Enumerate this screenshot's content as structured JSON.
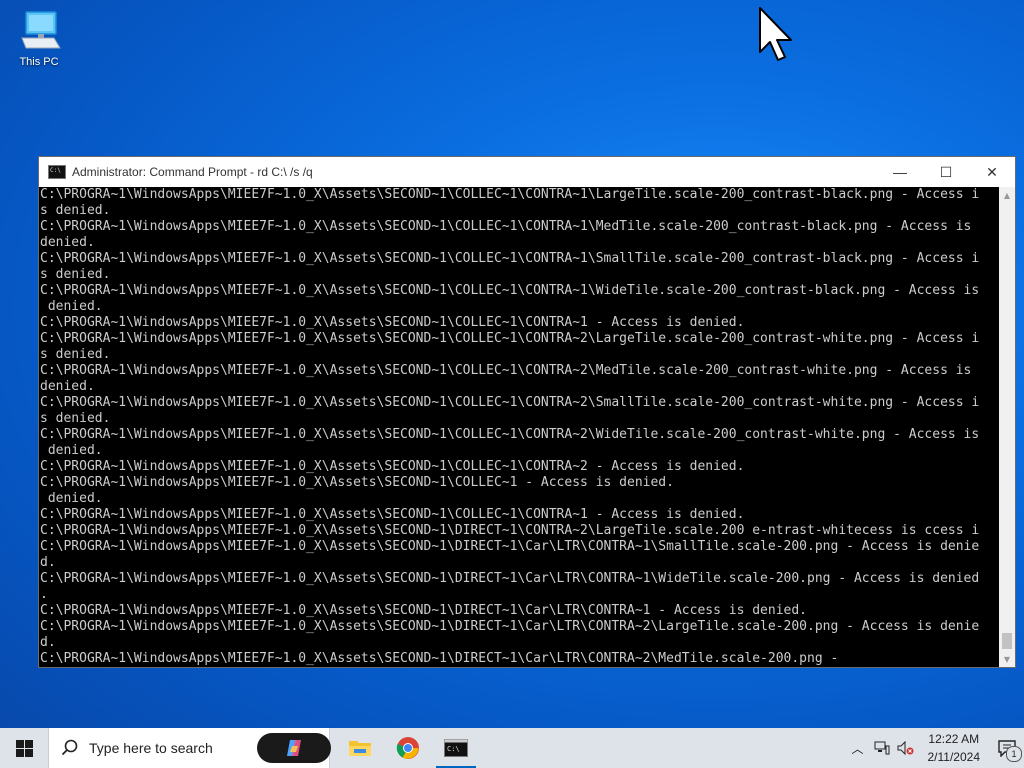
{
  "desktop": {
    "icons": [
      {
        "label": "This PC",
        "icon": "computer-icon"
      }
    ]
  },
  "window": {
    "title": "Administrator: Command Prompt - rd  C:\\ /s /q",
    "controls": {
      "minimize": "—",
      "maximize": "☐",
      "close": "✕"
    },
    "console_lines": [
      "C:\\PROGRA~1\\WindowsApps\\MIEE7F~1.0_X\\Assets\\SECOND~1\\COLLEC~1\\CONTRA~1\\LargeTile.scale-200_contrast-black.png - Access i",
      "s denied.",
      "C:\\PROGRA~1\\WindowsApps\\MIEE7F~1.0_X\\Assets\\SECOND~1\\COLLEC~1\\CONTRA~1\\MedTile.scale-200_contrast-black.png - Access is",
      "denied.",
      "C:\\PROGRA~1\\WindowsApps\\MIEE7F~1.0_X\\Assets\\SECOND~1\\COLLEC~1\\CONTRA~1\\SmallTile.scale-200_contrast-black.png - Access i",
      "s denied.",
      "C:\\PROGRA~1\\WindowsApps\\MIEE7F~1.0_X\\Assets\\SECOND~1\\COLLEC~1\\CONTRA~1\\WideTile.scale-200_contrast-black.png - Access is",
      " denied.",
      "C:\\PROGRA~1\\WindowsApps\\MIEE7F~1.0_X\\Assets\\SECOND~1\\COLLEC~1\\CONTRA~1 - Access is denied.",
      "C:\\PROGRA~1\\WindowsApps\\MIEE7F~1.0_X\\Assets\\SECOND~1\\COLLEC~1\\CONTRA~2\\LargeTile.scale-200_contrast-white.png - Access i",
      "s denied.",
      "C:\\PROGRA~1\\WindowsApps\\MIEE7F~1.0_X\\Assets\\SECOND~1\\COLLEC~1\\CONTRA~2\\MedTile.scale-200_contrast-white.png - Access is",
      "denied.",
      "C:\\PROGRA~1\\WindowsApps\\MIEE7F~1.0_X\\Assets\\SECOND~1\\COLLEC~1\\CONTRA~2\\SmallTile.scale-200_contrast-white.png - Access i",
      "s denied.",
      "C:\\PROGRA~1\\WindowsApps\\MIEE7F~1.0_X\\Assets\\SECOND~1\\COLLEC~1\\CONTRA~2\\WideTile.scale-200_contrast-white.png - Access is",
      " denied.",
      "C:\\PROGRA~1\\WindowsApps\\MIEE7F~1.0_X\\Assets\\SECOND~1\\COLLEC~1\\CONTRA~2 - Access is denied.",
      "C:\\PROGRA~1\\WindowsApps\\MIEE7F~1.0_X\\Assets\\SECOND~1\\COLLEC~1 - Access is denied.",
      " denied.",
      "C:\\PROGRA~1\\WindowsApps\\MIEE7F~1.0_X\\Assets\\SECOND~1\\COLLEC~1\\CONTRA~1 - Access is denied.",
      "C:\\PROGRA~1\\WindowsApps\\MIEE7F~1.0_X\\Assets\\SECOND~1\\DIRECT~1\\CONTRA~2\\LargeTile.scale.200 e-ntrast-whitecess is ccess i",
      "C:\\PROGRA~1\\WindowsApps\\MIEE7F~1.0_X\\Assets\\SECOND~1\\DIRECT~1\\Car\\LTR\\CONTRA~1\\SmallTile.scale-200.png - Access is denie",
      "d.",
      "C:\\PROGRA~1\\WindowsApps\\MIEE7F~1.0_X\\Assets\\SECOND~1\\DIRECT~1\\Car\\LTR\\CONTRA~1\\WideTile.scale-200.png - Access is denied",
      ".",
      "C:\\PROGRA~1\\WindowsApps\\MIEE7F~1.0_X\\Assets\\SECOND~1\\DIRECT~1\\Car\\LTR\\CONTRA~1 - Access is denied.",
      "C:\\PROGRA~1\\WindowsApps\\MIEE7F~1.0_X\\Assets\\SECOND~1\\DIRECT~1\\Car\\LTR\\CONTRA~2\\LargeTile.scale-200.png - Access is denie",
      "d.",
      "C:\\PROGRA~1\\WindowsApps\\MIEE7F~1.0_X\\Assets\\SECOND~1\\DIRECT~1\\Car\\LTR\\CONTRA~2\\MedTile.scale-200.png -"
    ]
  },
  "taskbar": {
    "search_placeholder": "Type here to search",
    "apps": [
      {
        "name": "file-explorer",
        "icon": "folder-icon",
        "active": false
      },
      {
        "name": "chrome",
        "icon": "chrome-icon",
        "active": false
      },
      {
        "name": "command-prompt",
        "icon": "terminal-icon",
        "active": true
      }
    ],
    "time": "12:22 AM",
    "date": "2/11/2024",
    "notification_count": "1"
  },
  "colors": {
    "console_bg": "#000000",
    "console_text": "#cccccc",
    "taskbar_bg": "#dee3ea",
    "accent": "#0067c0"
  }
}
